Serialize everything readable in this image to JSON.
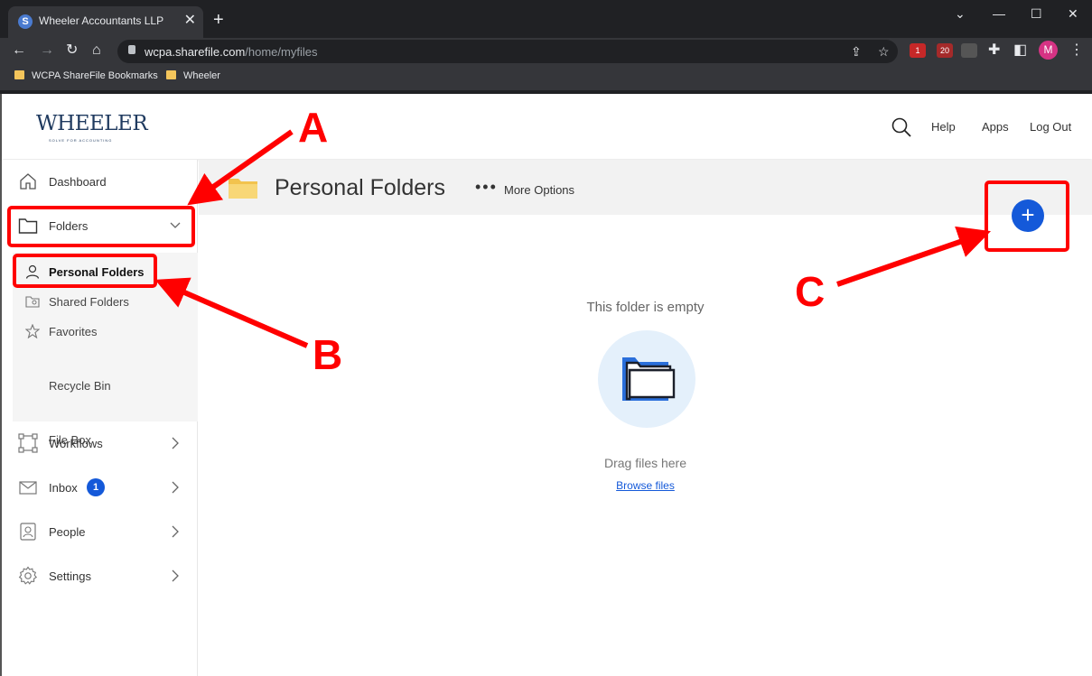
{
  "browser": {
    "tab_title": "Wheeler Accountants LLP",
    "tab_close": "✕",
    "new_tab": "+",
    "url_host": "wcpa.sharefile.com",
    "url_path": "/home/myfiles",
    "bookmarks": [
      "WCPA ShareFile Bookmarks",
      "Wheeler"
    ],
    "ext_badges": [
      "1",
      "20"
    ],
    "profile_initial": "M"
  },
  "header": {
    "logo_text": "WHEELER",
    "logo_tagline": "SOLVE FOR ACCOUNTING",
    "links": {
      "help": "Help",
      "apps": "Apps",
      "logout": "Log Out"
    }
  },
  "sidebar": {
    "dashboard": "Dashboard",
    "folders": "Folders",
    "sub": {
      "personal": "Personal Folders",
      "shared": "Shared Folders",
      "favorites": "Favorites",
      "filebox": "File Box",
      "recycle": "Recycle Bin"
    },
    "workflows": "Workflows",
    "inbox": "Inbox",
    "inbox_count": "1",
    "people": "People",
    "settings": "Settings"
  },
  "main": {
    "title": "Personal Folders",
    "more_dots": "•••",
    "more_options": "More Options",
    "add_label": "+",
    "empty_message": "This folder is empty",
    "drag_message": "Drag files here",
    "browse_link": "Browse files"
  },
  "annotations": {
    "a": "A",
    "b": "B",
    "c": "C",
    "color": "#ff0000"
  },
  "colors": {
    "accent": "#1459d9",
    "logo": "#1f3a5f"
  }
}
